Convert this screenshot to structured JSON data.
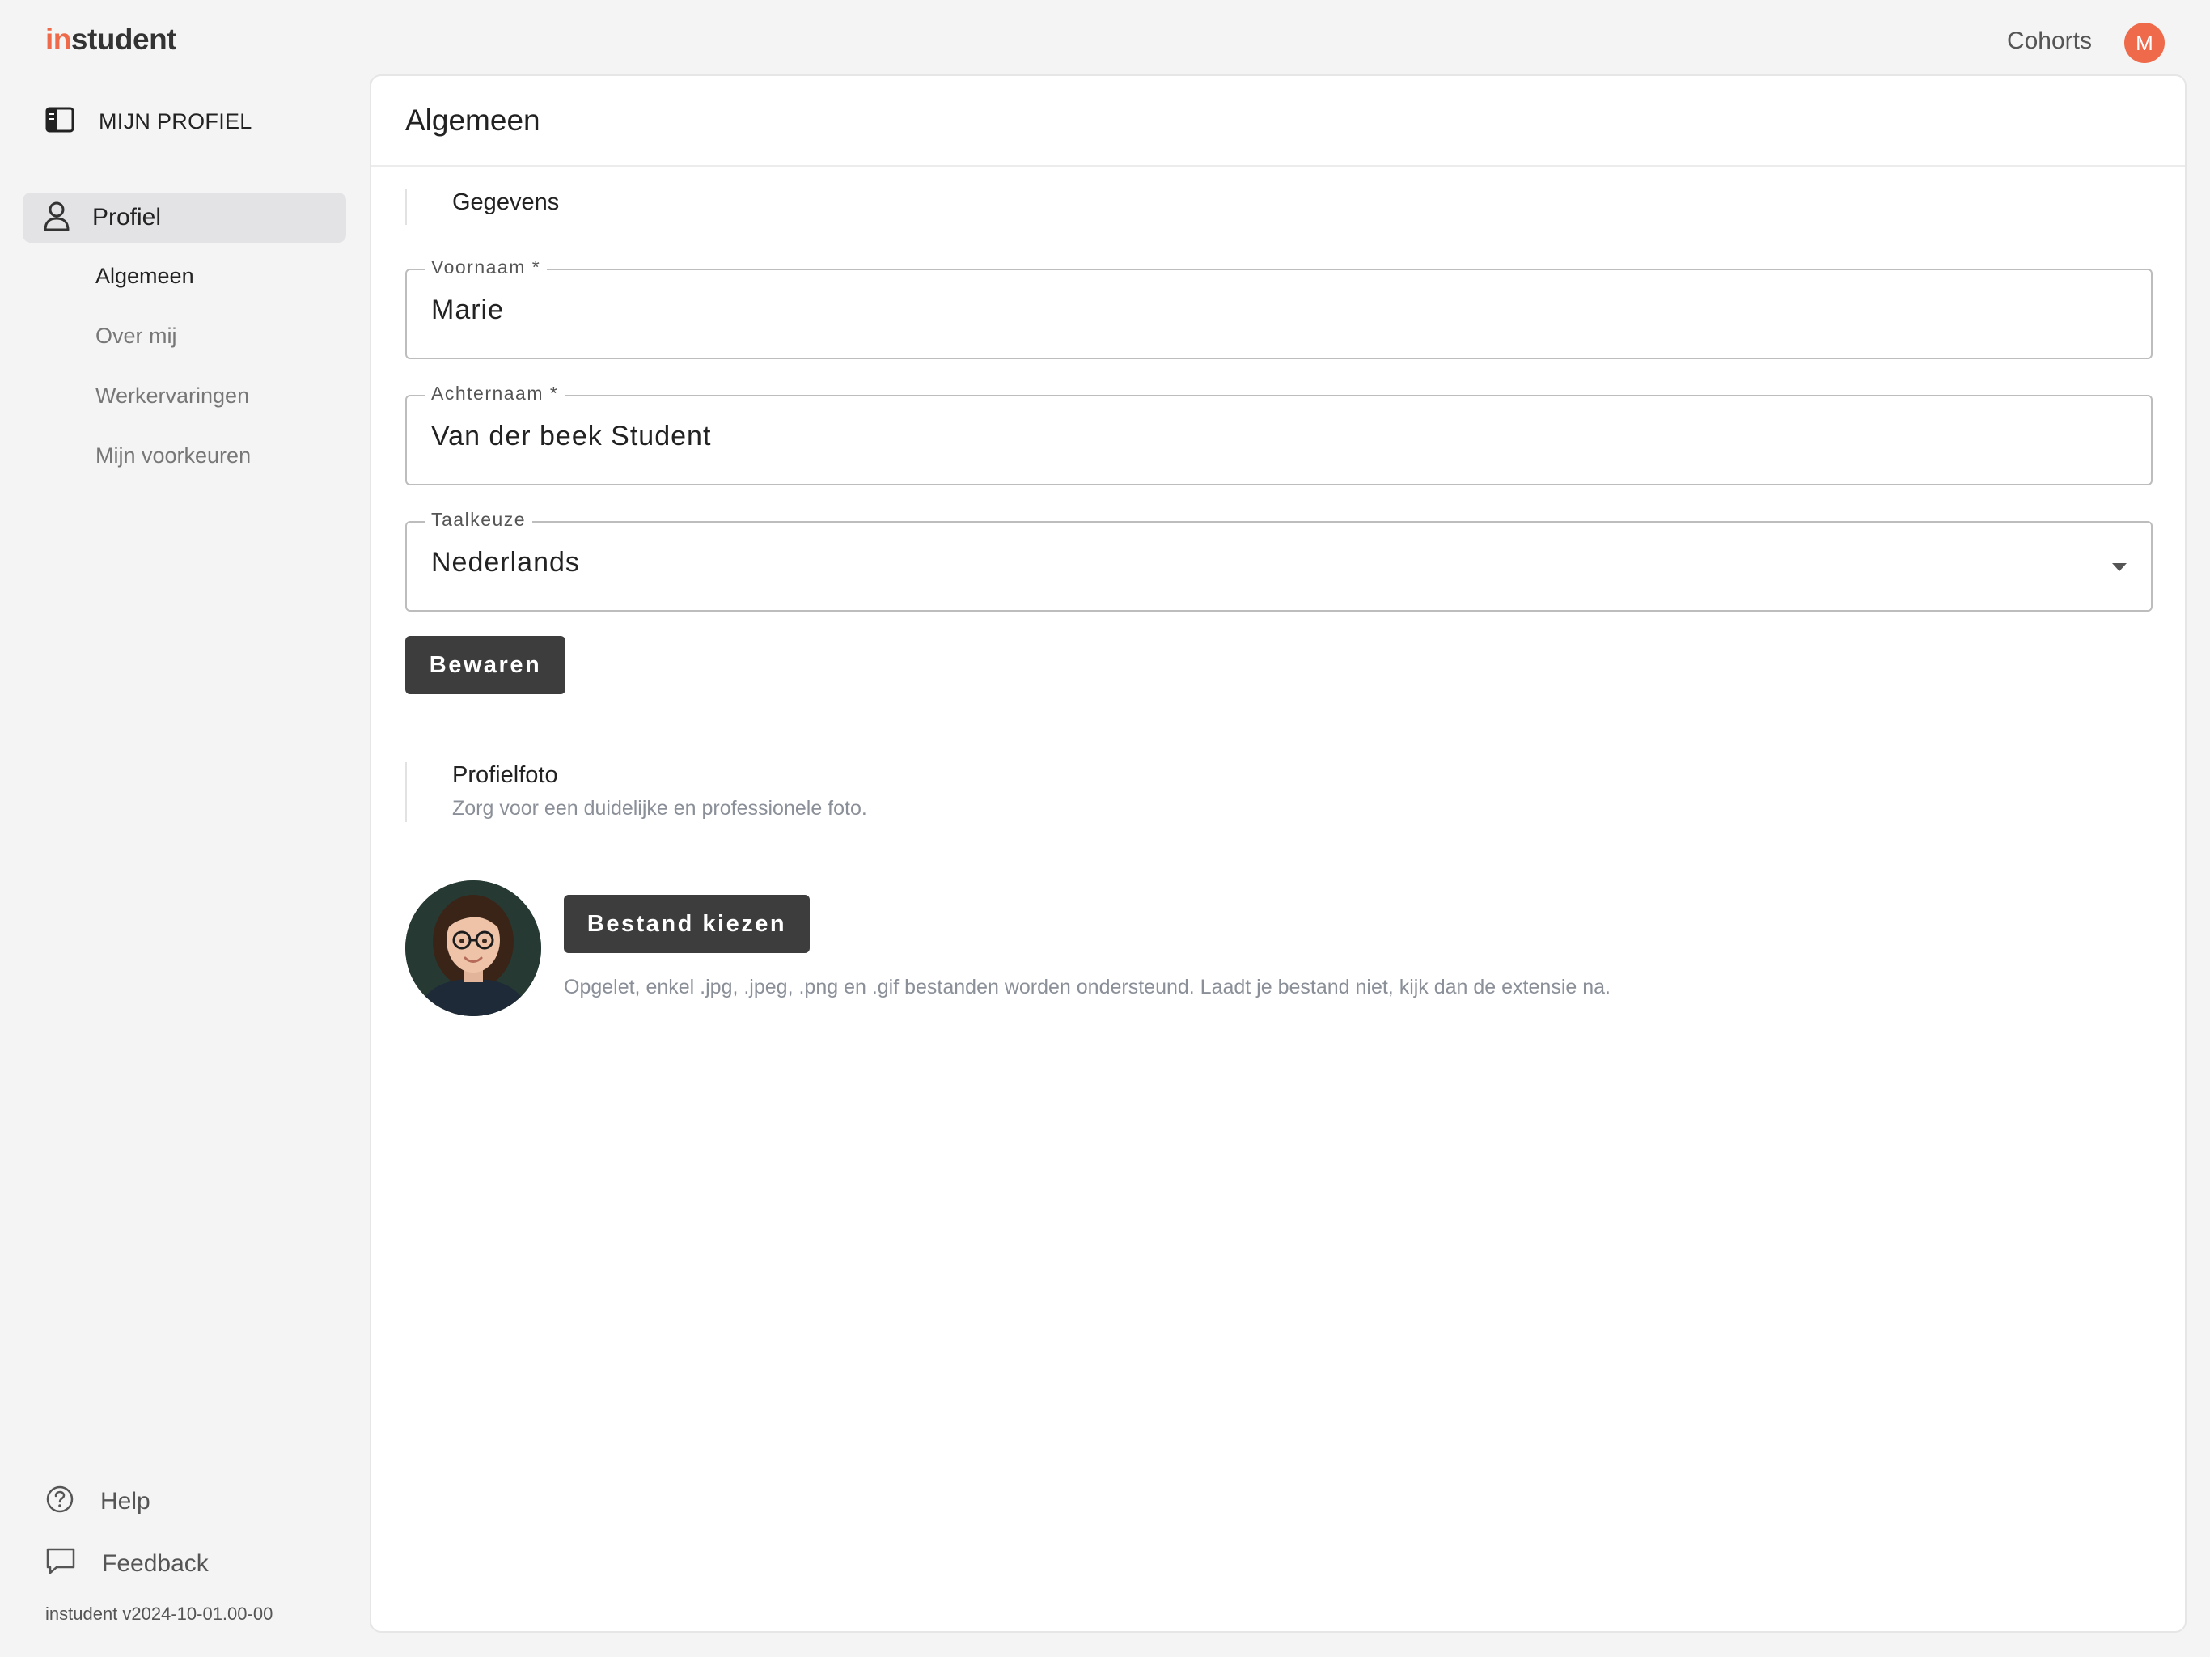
{
  "app": {
    "logo_prefix": "in",
    "logo_suffix": "student",
    "top_link": "Cohorts",
    "avatar_initial": "M",
    "accent_color": "#ee6a4b"
  },
  "sidebar": {
    "header": "MIJN PROFIEL",
    "active_item": "Profiel",
    "subitems": [
      "Algemeen",
      "Over mij",
      "Werkervaringen",
      "Mijn voorkeuren"
    ],
    "help": "Help",
    "feedback": "Feedback",
    "version": "instudent v2024-10-01.00-00"
  },
  "main": {
    "title": "Algemeen",
    "gegevens": {
      "heading": "Gegevens",
      "fields": {
        "voornaam": {
          "label": "Voornaam *",
          "value": "Marie"
        },
        "achternaam": {
          "label": "Achternaam *",
          "value": "Van der beek Student"
        },
        "taalkeuze": {
          "label": "Taalkeuze",
          "value": "Nederlands"
        }
      },
      "save_button": "Bewaren"
    },
    "profielfoto": {
      "heading": "Profielfoto",
      "subheading": "Zorg voor een duidelijke en professionele foto.",
      "choose_button": "Bestand kiezen",
      "hint": "Opgelet, enkel .jpg, .jpeg, .png en .gif bestanden worden ondersteund. Laadt je bestand niet, kijk dan de extensie na."
    }
  }
}
